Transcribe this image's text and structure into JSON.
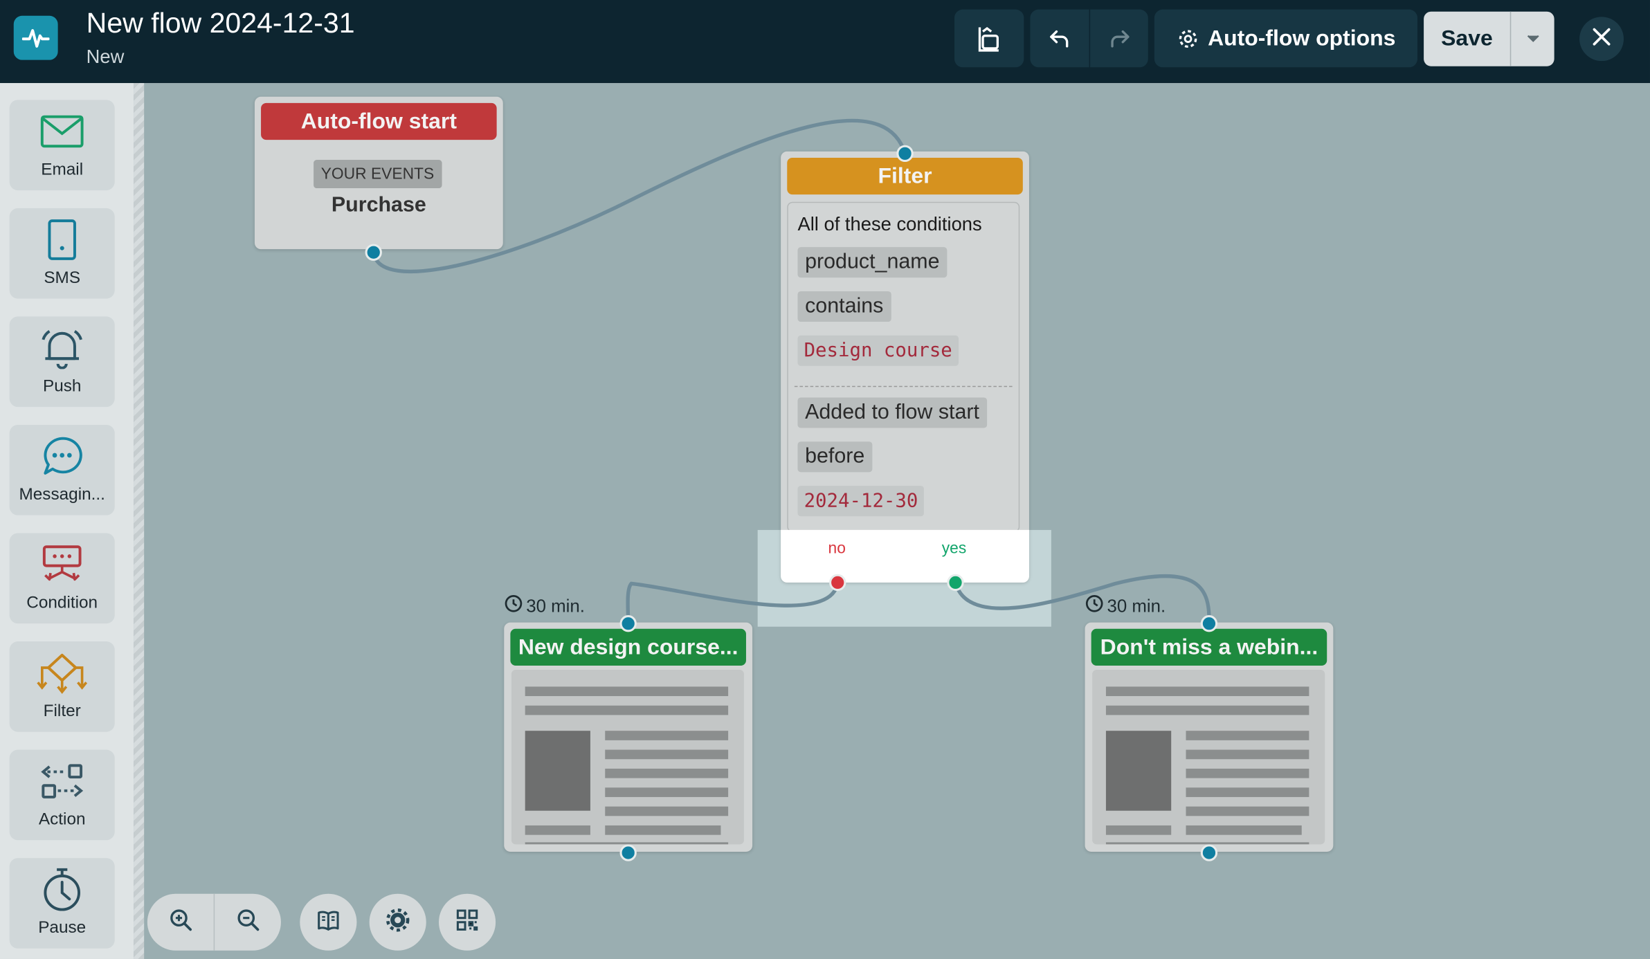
{
  "header": {
    "title": "New flow 2024-12-31",
    "subtitle": "New",
    "options_label": "Auto-flow options",
    "save_label": "Save",
    "icons": [
      "app-logo-icon",
      "segment-icon",
      "undo-icon",
      "redo-icon",
      "gear-icon",
      "chevron-down-icon",
      "close-icon"
    ]
  },
  "sidebar": {
    "items": [
      {
        "label": "Email",
        "icon": "envelope-icon"
      },
      {
        "label": "SMS",
        "icon": "phone-icon"
      },
      {
        "label": "Push",
        "icon": "bell-icon"
      },
      {
        "label": "Messagin...",
        "icon": "chat-bubble-icon"
      },
      {
        "label": "Condition",
        "icon": "condition-icon"
      },
      {
        "label": "Filter",
        "icon": "filter-icon"
      },
      {
        "label": "Action",
        "icon": "action-icon"
      },
      {
        "label": "Pause",
        "icon": "stopwatch-icon"
      }
    ]
  },
  "canvas": {
    "start": {
      "title": "Auto-flow start",
      "tag": "YOUR EVENTS",
      "event": "Purchase"
    },
    "filter": {
      "title": "Filter",
      "conditions_title": "All of these conditions",
      "cond1_field": "product_name",
      "cond1_op": "contains",
      "cond1_value": "Design course",
      "cond2_field": "Added to flow start",
      "cond2_op": "before",
      "cond2_value": "2024-12-30",
      "branch_no": "no",
      "branch_yes": "yes"
    },
    "email_left": {
      "title": "New design course...",
      "delay": "30 min."
    },
    "email_right": {
      "title": "Don't miss a webin...",
      "delay": "30 min."
    }
  },
  "colors": {
    "topbar": "#0d2530",
    "canvas": "#9aaeb1",
    "start_header": "#c0393b",
    "filter_header": "#d6921f",
    "email_header": "#1e8a3f",
    "port": "#0f7fa1",
    "no": "#d9363e",
    "yes": "#12a56b"
  },
  "bottom_toolbar": {
    "icons": [
      "zoom-in-icon",
      "zoom-out-icon",
      "book-icon",
      "settings-gear-icon",
      "minimap-icon"
    ]
  }
}
